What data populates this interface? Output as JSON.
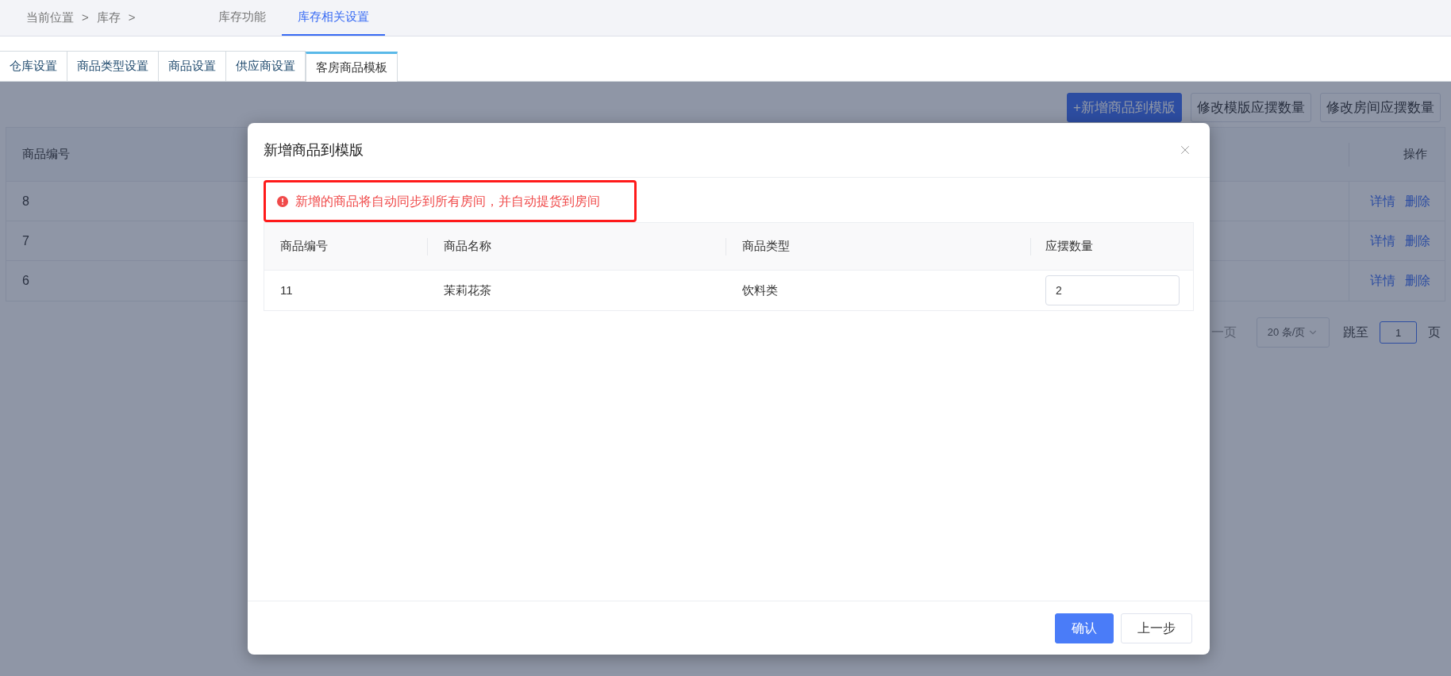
{
  "breadcrumb": [
    "当前位置",
    ">",
    "库存",
    ">"
  ],
  "top_tabs": [
    {
      "label": "库存功能",
      "selected": false
    },
    {
      "label": "库存相关设置",
      "selected": true
    }
  ],
  "sub_tabs": [
    {
      "label": "仓库设置",
      "selected": false
    },
    {
      "label": "商品类型设置",
      "selected": false
    },
    {
      "label": "商品设置",
      "selected": false
    },
    {
      "label": "供应商设置",
      "selected": false
    },
    {
      "label": "客房商品模板",
      "selected": true
    }
  ],
  "toolbar_buttons": [
    {
      "label": "+新增商品到模版",
      "kind": "primary"
    },
    {
      "label": "修改模版应摆数量",
      "kind": "default"
    },
    {
      "label": "修改房间应摆数量",
      "kind": "default"
    }
  ],
  "table": {
    "columns": [
      "商品编号",
      "操作"
    ],
    "rows": [
      {
        "id": "8",
        "actions": [
          "详情",
          "删除"
        ]
      },
      {
        "id": "7",
        "actions": [
          "详情",
          "删除"
        ]
      },
      {
        "id": "6",
        "actions": [
          "详情",
          "删除"
        ]
      }
    ]
  },
  "pagination": {
    "prev_fragment": "一页",
    "page_size": "20 条/页",
    "jump_label": "跳至",
    "page_input": "1",
    "page_suffix": "页"
  },
  "dialog": {
    "title": "新增商品到模版",
    "warning": "新增的商品将自动同步到所有房间，并自动提货到房间",
    "columns": [
      "商品编号",
      "商品名称",
      "商品类型",
      "应摆数量"
    ],
    "rows": [
      {
        "cells": [
          "11",
          "茉莉花茶",
          "饮料类"
        ],
        "quantity": "2"
      }
    ],
    "buttons": [
      {
        "label": "确认",
        "kind": "primary"
      },
      {
        "label": "上一步",
        "kind": "default"
      }
    ]
  }
}
